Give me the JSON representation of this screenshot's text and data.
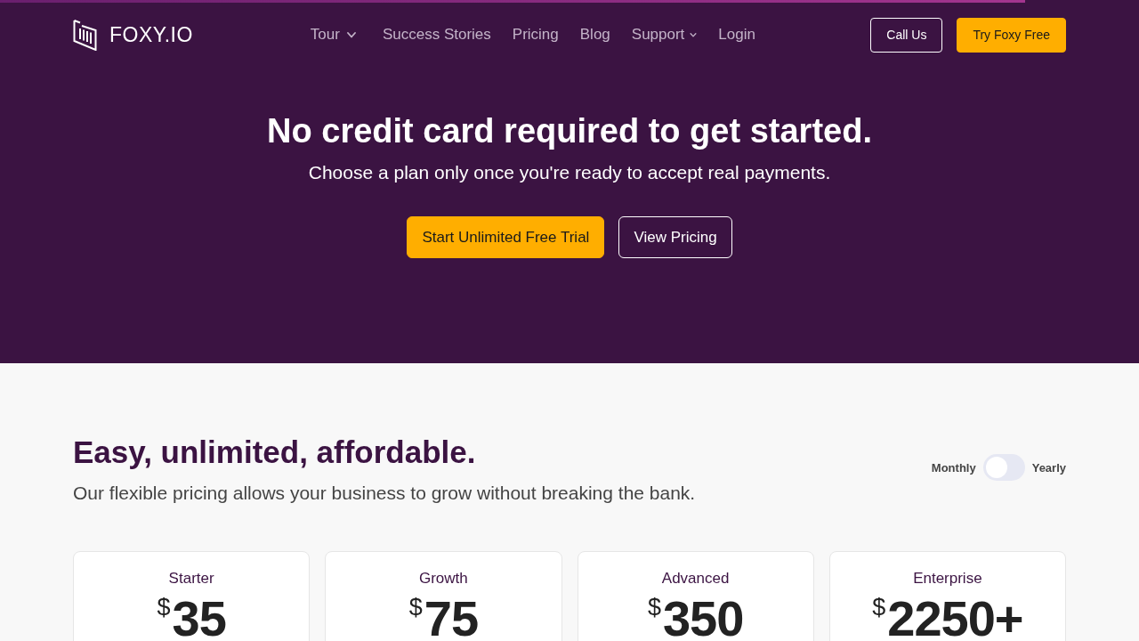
{
  "progress_bar": {
    "level": 0.9
  },
  "header": {
    "logo": "FOXY.IO",
    "nav": [
      {
        "label": "Tour",
        "kind": "dropdown"
      },
      {
        "label": "Success Stories",
        "kind": "link"
      },
      {
        "label": "Pricing",
        "kind": "link"
      },
      {
        "label": "Blog",
        "kind": "link"
      },
      {
        "label": "Support",
        "kind": "dropdown"
      },
      {
        "label": "Login",
        "kind": "link"
      }
    ],
    "actions": [
      {
        "label": "Call Us",
        "kind": "outline"
      },
      {
        "label": "Try Foxy Free",
        "kind": "primary"
      }
    ]
  },
  "hero": {
    "title": "No credit card required to get started.",
    "subtitle": "Choose a plan only once you're ready to accept real payments.",
    "buttons": [
      {
        "label": "Start Unlimited Free Trial",
        "kind": "primary"
      },
      {
        "label": "View Pricing",
        "kind": "outline"
      }
    ]
  },
  "pricing": {
    "title": "Easy, unlimited, affordable.",
    "subtitle": "Our flexible pricing allows your business to grow without breaking the bank.",
    "billing_toggle": {
      "left_label": "Monthly",
      "right_label": "Yearly",
      "on": false
    },
    "plans": [
      {
        "name": "Starter",
        "currency": "$",
        "price": "35"
      },
      {
        "name": "Growth",
        "currency": "$",
        "price": "75"
      },
      {
        "name": "Advanced",
        "currency": "$",
        "price": "350"
      },
      {
        "name": "Enterprise",
        "currency": "$",
        "price": "2250+"
      }
    ]
  }
}
